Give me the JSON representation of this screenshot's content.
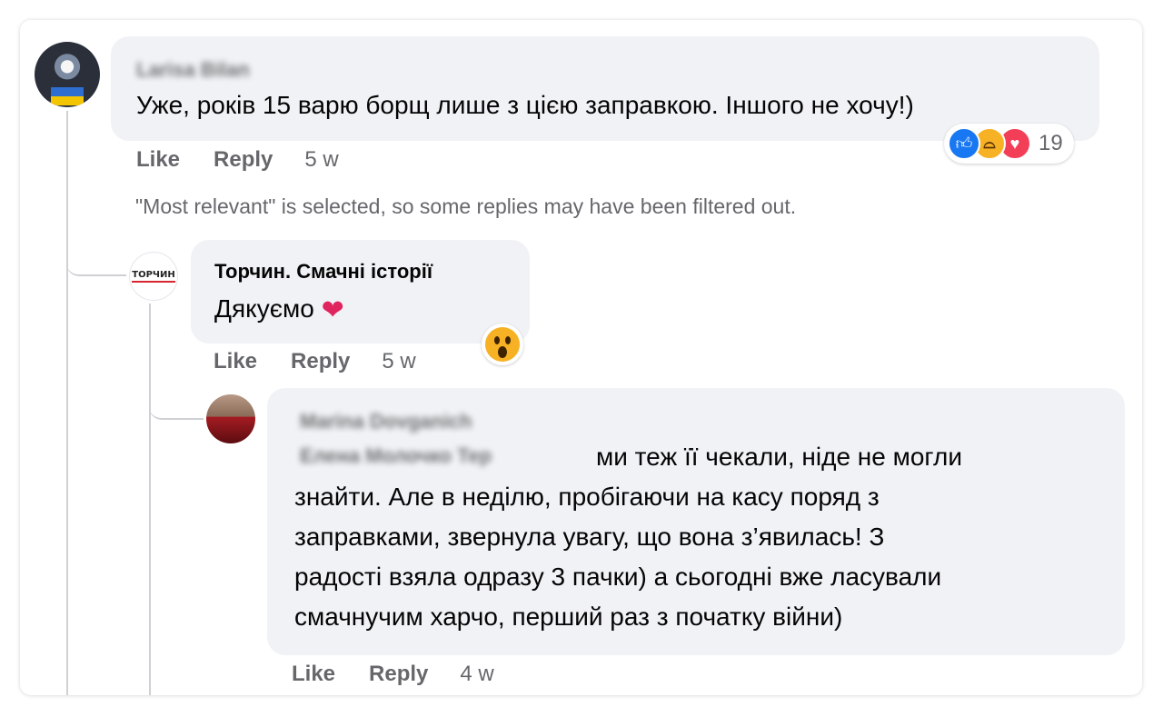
{
  "colors": {
    "bubble_bg": "#f0f2f5",
    "secondary_text": "#65676b",
    "like_blue": "#1877f2",
    "haha_yellow": "#f7b125",
    "love_red": "#f33e58",
    "brand_red": "#d7262e"
  },
  "comment1": {
    "author": "Larisa Bilan",
    "text": "Уже, років 15 варю борщ лише з цією заправкою. Іншого не хочу!)",
    "like_label": "Like",
    "reply_label": "Reply",
    "time": "5 w",
    "reactions": {
      "icons": [
        "like-icon",
        "haha-icon",
        "love-icon"
      ],
      "count": "19"
    }
  },
  "filter_notice": "\"Most relevant\" is selected, so some replies may have been filtered out.",
  "comment2": {
    "author": "Торчин. Смачні історії",
    "avatar_logo_text": "ТОРЧИН",
    "text": "Дякуємо",
    "emoji": "heart",
    "like_label": "Like",
    "reply_label": "Reply",
    "time": "5 w",
    "reaction_icon": "wow-icon"
  },
  "comment3": {
    "author": "Marina Dovganich",
    "mention": "Елена Молочко Тер",
    "lines": [
      "ми теж її чекали, ніде не могли",
      "знайти. Але в неділю, пробігаючи на касу поряд з",
      "заправками, звернула увагу, що вона з’явилась! З",
      "радості взяла одразу 3 пачки) а сьогодні вже ласували",
      "смачнучим харчо, перший раз з початку війни)"
    ],
    "like_label": "Like",
    "reply_label": "Reply",
    "time": "4 w"
  }
}
